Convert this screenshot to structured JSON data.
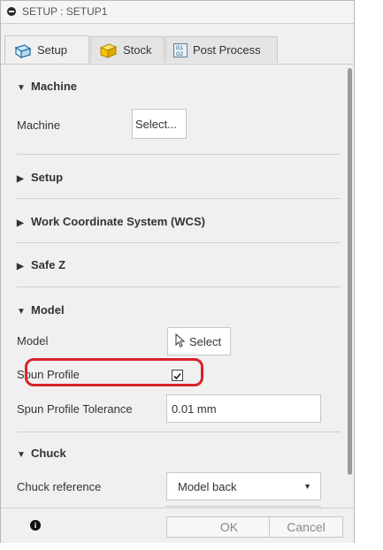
{
  "title": "SETUP : SETUP1",
  "tabs": [
    {
      "label": "Setup",
      "icon": "setup-icon"
    },
    {
      "label": "Stock",
      "icon": "stock-icon"
    },
    {
      "label": "Post Process",
      "icon": "post-process-icon"
    }
  ],
  "sections": {
    "machine": {
      "title": "Machine",
      "expanded": true,
      "label": "Machine",
      "button": "Select..."
    },
    "setup": {
      "title": "Setup",
      "expanded": false
    },
    "wcs": {
      "title": "Work Coordinate System (WCS)",
      "expanded": false
    },
    "safez": {
      "title": "Safe Z",
      "expanded": false
    },
    "model": {
      "title": "Model",
      "expanded": true,
      "model_label": "Model",
      "model_button": "Select",
      "spun_label": "Spun Profile",
      "spun_checked": true,
      "tolerance_label": "Spun Profile Tolerance",
      "tolerance_value": "0.01 mm"
    },
    "chuck": {
      "title": "Chuck",
      "expanded": true,
      "ref_label": "Chuck reference",
      "ref_value": "Model back"
    }
  },
  "footer": {
    "ok": "OK",
    "cancel": "Cancel",
    "info_icon": "info-icon"
  },
  "colors": {
    "highlight": "#d7232a"
  }
}
